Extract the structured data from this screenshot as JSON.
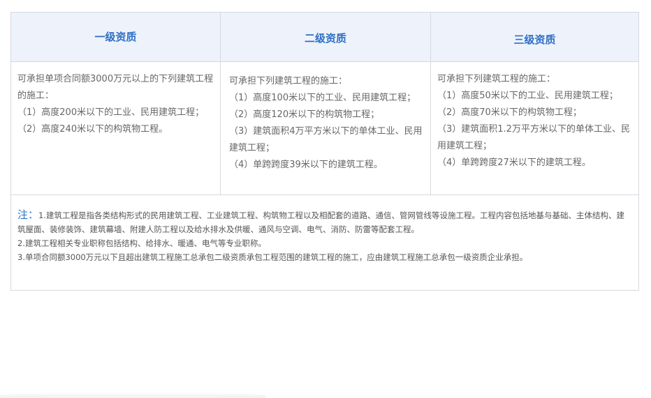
{
  "headers": [
    "一级资质",
    "二级资质",
    "三级资质"
  ],
  "columns": [
    {
      "lines": [
        "可承担单项合同额3000万元以上的下列建筑工程的施工：",
        "（1）高度200米以下的工业、民用建筑工程；",
        "（2）高度240米以下的构筑物工程。"
      ]
    },
    {
      "lines": [
        "可承担下列建筑工程的施工：",
        "（1）高度100米以下的工业、民用建筑工程；",
        "（2）高度120米以下的构筑物工程；",
        "（3）建筑面积4万平方米以下的单体工业、民用建筑工程；",
        "（4）单跨跨度39米以下的建筑工程。"
      ]
    },
    {
      "lines": [
        "可承担下列建筑工程的施工：",
        "（1）高度50米以下的工业、民用建筑工程；",
        "（2）高度70米以下的构筑物工程；",
        "（3）建筑面积1.2万平方米以下的单体工业、民用建筑工程；",
        "（4）单跨跨度27米以下的建筑工程。"
      ]
    }
  ],
  "notes": {
    "title": "注：",
    "items": [
      "1.建筑工程是指各类结构形式的民用建筑工程、工业建筑工程、构筑物工程以及相配套的道路、通信、管网管线等设施工程。工程内容包括地基与基础、主体结构、建筑屋面、装修装饰、建筑幕墙、附建人防工程以及给水排水及供暖、通风与空调、电气、消防、防雷等配套工程。",
      "2.建筑工程相关专业职称包括结构、给排水、暖通、电气等专业职称。",
      "3.单项合同额3000万元以下且超出建筑工程施工总承包二级资质承包工程范围的建筑工程的施工，应由建筑工程施工总承包一级资质企业承担。"
    ]
  },
  "colors": {
    "header_text": "#2f6fc6",
    "header_bg": "#eef3fb",
    "border": "#d6d9de",
    "body_text": "#666666"
  }
}
